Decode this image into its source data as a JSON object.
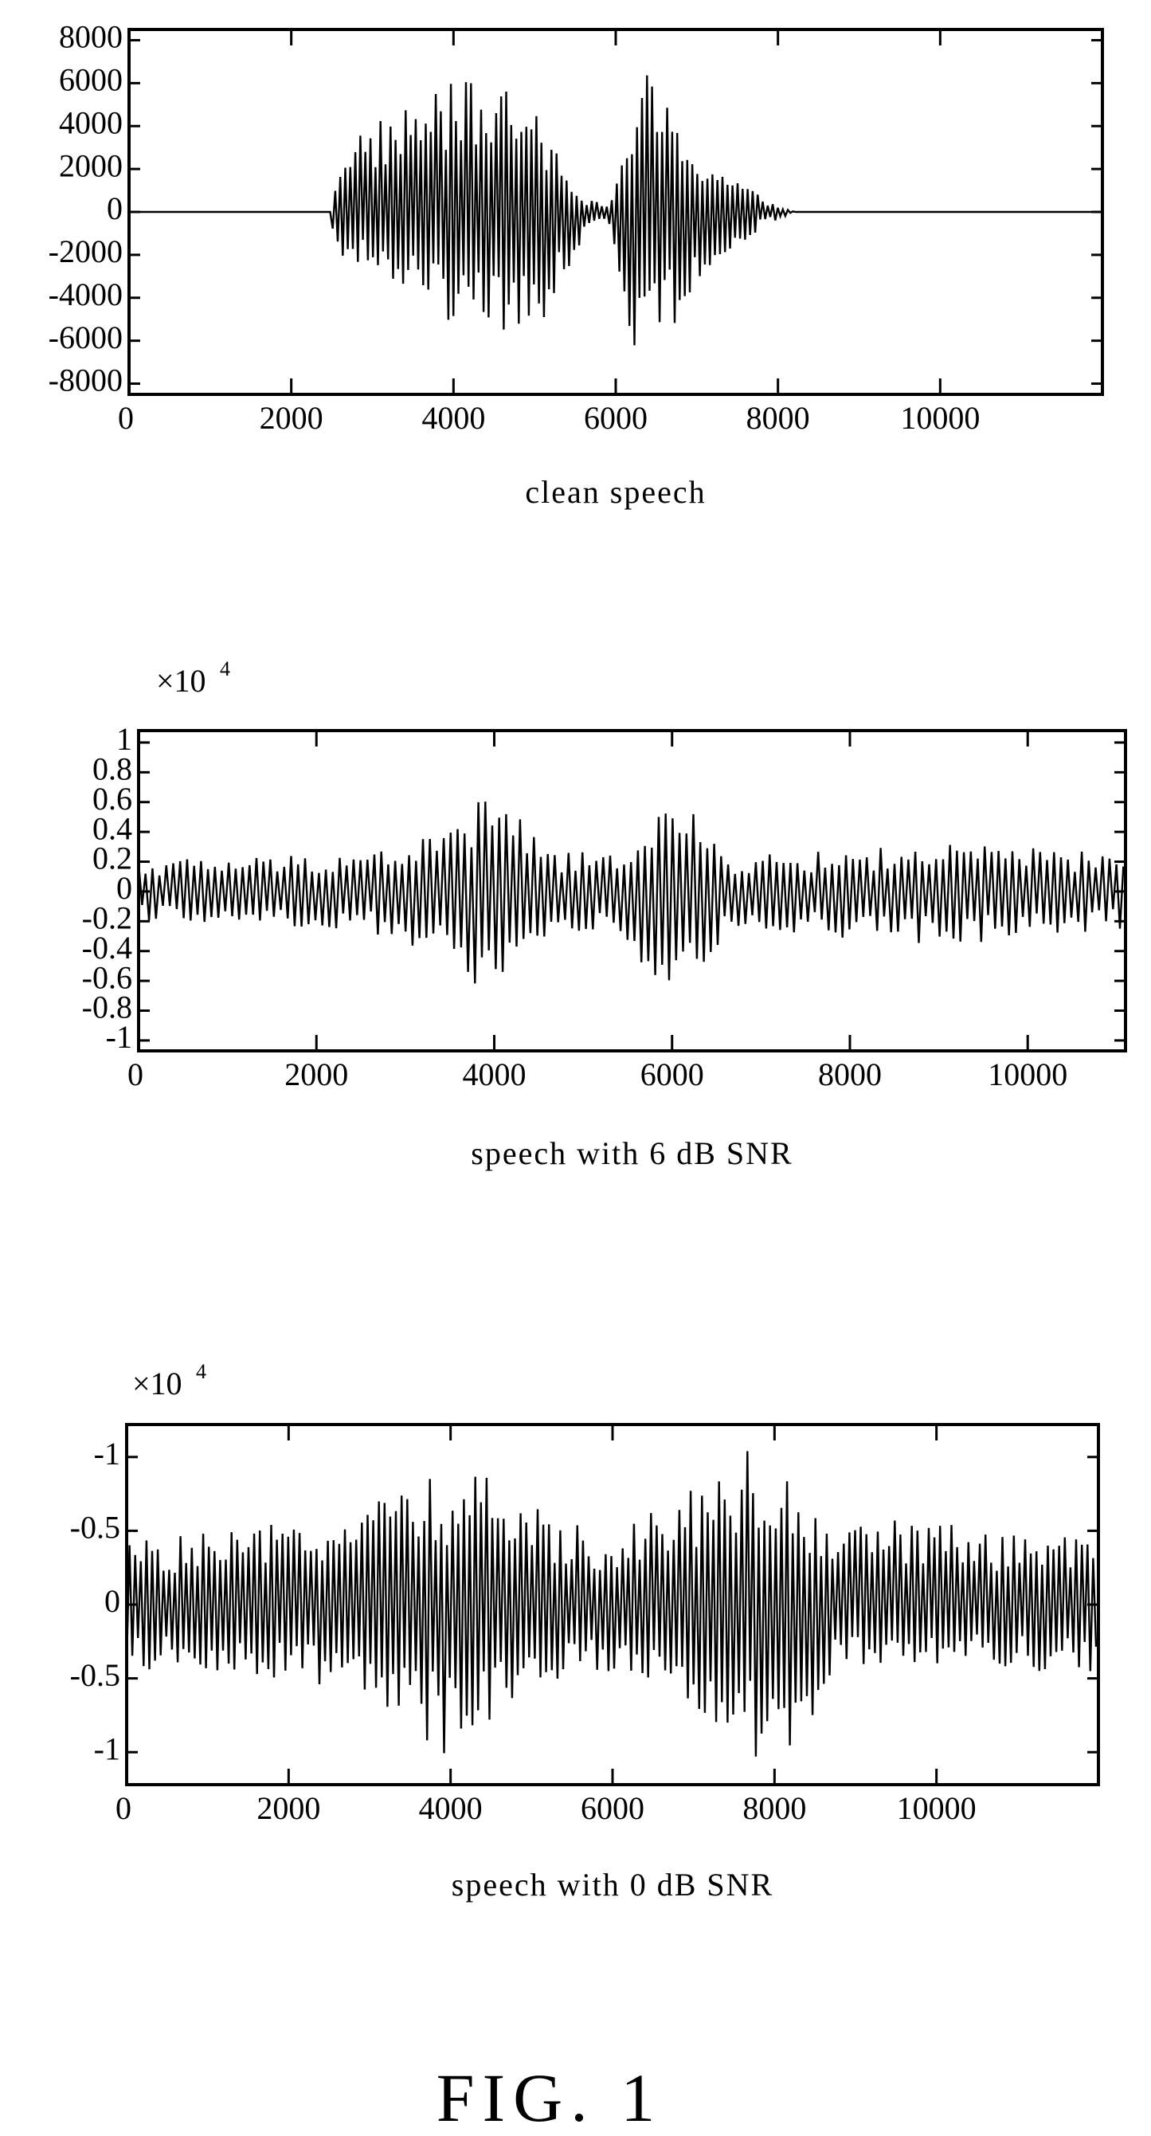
{
  "figure": {
    "caption": "FIG. 1"
  },
  "chart_data": [
    {
      "type": "line",
      "title": "",
      "xlabel": "clean speech",
      "ylabel": "",
      "y_multiplier": "",
      "xlim": [
        0,
        12000
      ],
      "ylim": [
        -8500,
        8500
      ],
      "x_ticks": [
        0,
        2000,
        4000,
        6000,
        8000,
        10000
      ],
      "x_tick_labels": [
        "0",
        "2000",
        "4000",
        "6000",
        "8000",
        "10000"
      ],
      "y_ticks": [
        8000,
        6000,
        4000,
        2000,
        0,
        -2000,
        -4000,
        -6000,
        -8000
      ],
      "y_tick_labels": [
        "8000",
        "6000",
        "4000",
        "2000",
        "0",
        "-2000",
        "-4000",
        "-6000",
        "-8000"
      ],
      "grid": false,
      "legend": "none",
      "series": [
        {
          "name": "clean speech waveform",
          "description": "Silence until ~2500 samples, voiced segment ~2500-5900 peaking near +/-6000 around sample 4000-4800, brief quiet near 5800-6000, second voiced burst ~6000-8200 peaking ~+6700/-7400 near 6400, silence after ~8200.",
          "envelope_x": [
            0,
            2480,
            2500,
            2700,
            3000,
            3400,
            3800,
            4200,
            4600,
            4800,
            5100,
            5400,
            5650,
            5900,
            6000,
            6200,
            6400,
            6600,
            7000,
            7400,
            7800,
            8200,
            12000
          ],
          "envelope_upper": [
            0,
            0,
            1200,
            3800,
            4200,
            5000,
            5900,
            6100,
            6100,
            5400,
            4200,
            2500,
            600,
            300,
            1500,
            4800,
            6700,
            5200,
            3000,
            1800,
            700,
            0,
            0
          ],
          "envelope_lower": [
            0,
            0,
            -800,
            -3000,
            -2500,
            -3800,
            -4700,
            -5800,
            -6600,
            -6500,
            -5000,
            -3200,
            -800,
            -300,
            -2500,
            -6200,
            -7400,
            -6000,
            -3400,
            -2000,
            -700,
            0,
            0
          ],
          "oscillation_period": 62
        }
      ]
    },
    {
      "type": "line",
      "title": "",
      "xlabel": "speech with 6 dB SNR",
      "ylabel": "",
      "y_multiplier": "×10",
      "y_multiplier_exponent": "4",
      "xlim": [
        0,
        11100
      ],
      "ylim": [
        -1.07,
        1.08
      ],
      "x_ticks": [
        0,
        2000,
        4000,
        6000,
        8000,
        10000
      ],
      "x_tick_labels": [
        "0",
        "2000",
        "4000",
        "6000",
        "8000",
        "10000"
      ],
      "y_ticks": [
        1,
        0.8,
        0.6,
        0.4,
        0.2,
        0,
        -0.2,
        -0.4,
        -0.6,
        -0.8,
        -1
      ],
      "y_tick_labels": [
        "1",
        "0.8",
        "0.6",
        "0.4",
        "0.2",
        "0",
        "-0.2",
        "-0.4",
        "-0.6",
        "-0.8",
        "-1"
      ],
      "grid": false,
      "legend": "none",
      "series": [
        {
          "name": "speech with 6 dB SNR waveform",
          "description": "Noisy signal, baseline noise about +/-0.2 (x10^4); bursts near 3000-4300 (peak ~+0.77, ~-0.7) and 5500-6200 (peak ~+0.62, ~-0.83).",
          "envelope_x": [
            0,
            1500,
            2800,
            3400,
            3800,
            4000,
            4300,
            4600,
            5300,
            5600,
            5900,
            6200,
            6600,
            7500,
            8300,
            9500,
            11100
          ],
          "envelope_upper": [
            0.22,
            0.24,
            0.3,
            0.42,
            0.6,
            0.77,
            0.5,
            0.28,
            0.25,
            0.45,
            0.62,
            0.55,
            0.25,
            0.26,
            0.3,
            0.32,
            0.25
          ],
          "envelope_lower": [
            -0.2,
            -0.22,
            -0.3,
            -0.45,
            -0.65,
            -0.7,
            -0.55,
            -0.3,
            -0.25,
            -0.55,
            -0.83,
            -0.6,
            -0.3,
            -0.28,
            -0.35,
            -0.35,
            -0.25
          ],
          "oscillation_period": 78
        }
      ]
    },
    {
      "type": "line",
      "title": "",
      "xlabel": "speech with 0 dB SNR",
      "ylabel": "",
      "y_multiplier": "×10",
      "y_multiplier_exponent": "4",
      "xlim": [
        0,
        12000
      ],
      "ylim": [
        1.22,
        -1.22
      ],
      "y_axis_note": "tick labels printed as shown in figure (upper ticks also labelled negative)",
      "x_ticks": [
        0,
        2000,
        4000,
        6000,
        8000,
        10000
      ],
      "x_tick_labels": [
        "0",
        "2000",
        "4000",
        "6000",
        "8000",
        "10000"
      ],
      "y_ticks": [
        1,
        0.5,
        0,
        -0.5,
        -1
      ],
      "y_tick_labels": [
        "-1",
        "-0.5",
        "0",
        "-0.5",
        "-1"
      ],
      "grid": false,
      "legend": "none",
      "series": [
        {
          "name": "speech with 0 dB SNR waveform",
          "description": "Heavily noisy signal with noise floor about +/-0.45 (x10^4); louder regions near 2500-4800 (peaks ~+/-1.05) and 7000-8400 (peaks ~+1.07, ~-1.08).",
          "envelope_x": [
            0,
            1500,
            2500,
            3300,
            4000,
            4600,
            5200,
            6000,
            7000,
            7700,
            8300,
            8700,
            9700,
            10500,
            12000
          ],
          "envelope_upper": [
            0.45,
            0.45,
            0.65,
            0.8,
            1.05,
            0.75,
            0.55,
            0.45,
            0.7,
            1.07,
            0.98,
            0.5,
            0.45,
            0.45,
            0.5
          ],
          "envelope_lower": [
            -0.45,
            -0.5,
            -0.65,
            -0.8,
            -0.9,
            -0.85,
            -0.6,
            -0.5,
            -0.85,
            -1.08,
            -0.8,
            -0.55,
            -0.6,
            -0.5,
            -0.45
          ],
          "oscillation_period": 70
        }
      ]
    }
  ]
}
